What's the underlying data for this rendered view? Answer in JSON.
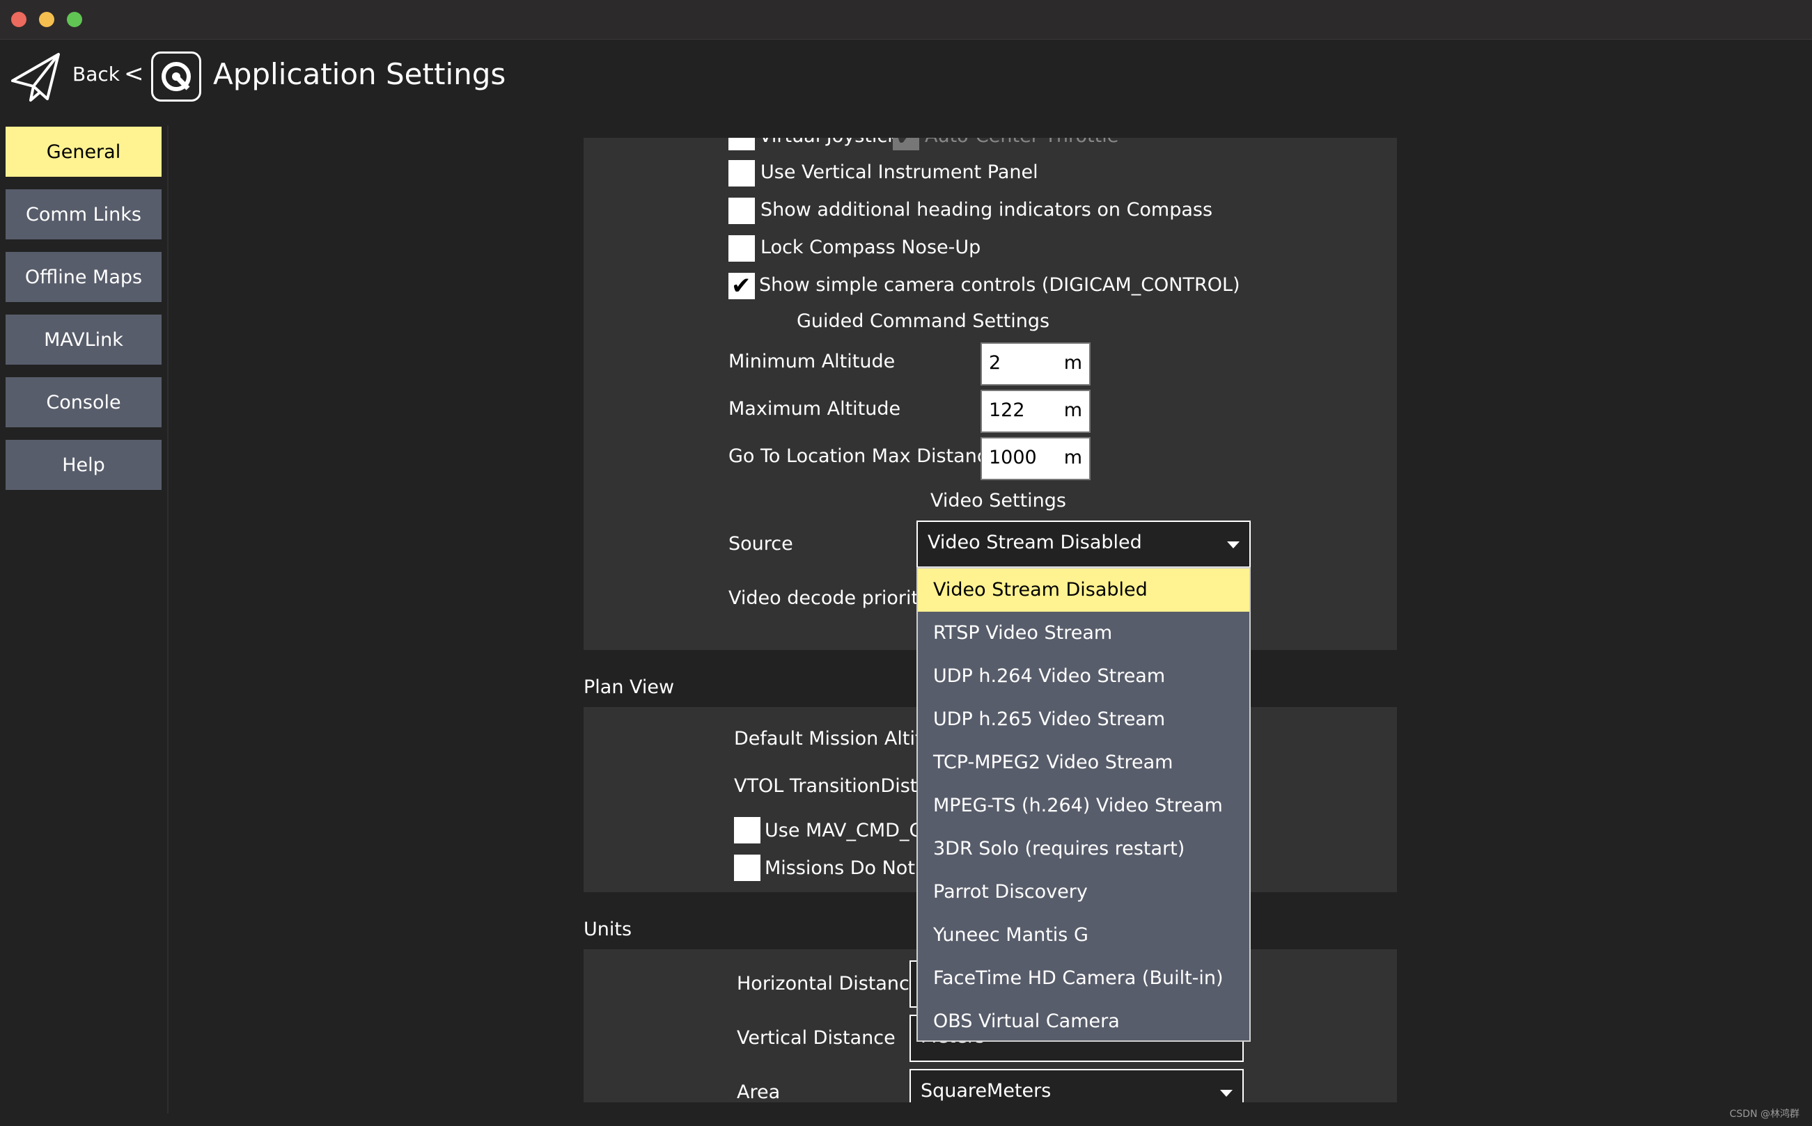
{
  "header": {
    "back_label": "Back",
    "chevron": "<",
    "title": "Application Settings",
    "back_icon": "paper-plane-icon",
    "logo_icon": "qgc-logo-icon"
  },
  "window": {
    "traffic_light_colors": [
      "#ed6a5e",
      "#f4bf4f",
      "#61c554"
    ]
  },
  "sidebar": {
    "items": [
      {
        "label": "General",
        "active": true
      },
      {
        "label": "Comm Links",
        "active": false
      },
      {
        "label": "Offline Maps",
        "active": false
      },
      {
        "label": "MAVLink",
        "active": false
      },
      {
        "label": "Console",
        "active": false
      },
      {
        "label": "Help",
        "active": false
      }
    ]
  },
  "general": {
    "partial_checkbox_label": "Virtual Joystick",
    "partial_checkbox_label_2": "Auto-Center Throttle",
    "checkboxes": [
      {
        "label": "Use Vertical Instrument Panel",
        "checked": false
      },
      {
        "label": "Show additional heading indicators on Compass",
        "checked": false
      },
      {
        "label": "Lock Compass Nose-Up",
        "checked": false
      },
      {
        "label": "Show simple camera controls (DIGICAM_CONTROL)",
        "checked": true
      }
    ],
    "guided_title": "Guided Command Settings",
    "fields": [
      {
        "label": "Minimum Altitude",
        "value": "2",
        "unit": "m"
      },
      {
        "label": "Maximum Altitude",
        "value": "122",
        "unit": "m"
      },
      {
        "label": "Go To Location Max Distance",
        "value": "1000",
        "unit": "m"
      }
    ],
    "video_title": "Video Settings",
    "source_label": "Source",
    "source_value": "Video Stream Disabled",
    "decode_label": "Video decode priority"
  },
  "plan_view": {
    "title": "Plan View",
    "default_altitude_label": "Default Mission Altitude",
    "vtol_label": "VTOL TransitionDistance",
    "checkbox_1": "Use MAV_CMD_CONDITION_GATE",
    "checkbox_2": "Missions Do Not Require Takeoff Item"
  },
  "units": {
    "title": "Units",
    "horizontal_label": "Horizontal Distance",
    "vertical_label": "Vertical Distance",
    "vertical_value": "Meters",
    "area_label": "Area",
    "area_value": "SquareMeters"
  },
  "dropdown": {
    "options": [
      "Video Stream Disabled",
      "RTSP Video Stream",
      "UDP h.264 Video Stream",
      "UDP h.265 Video Stream",
      "TCP-MPEG2 Video Stream",
      "MPEG-TS (h.264) Video Stream",
      "3DR Solo (requires restart)",
      "Parrot Discovery",
      "Yuneec Mantis G",
      "FaceTime HD Camera (Built-in)",
      "OBS Virtual Camera"
    ],
    "selected_index": 0
  },
  "watermark": "CSDN @林鸿群"
}
